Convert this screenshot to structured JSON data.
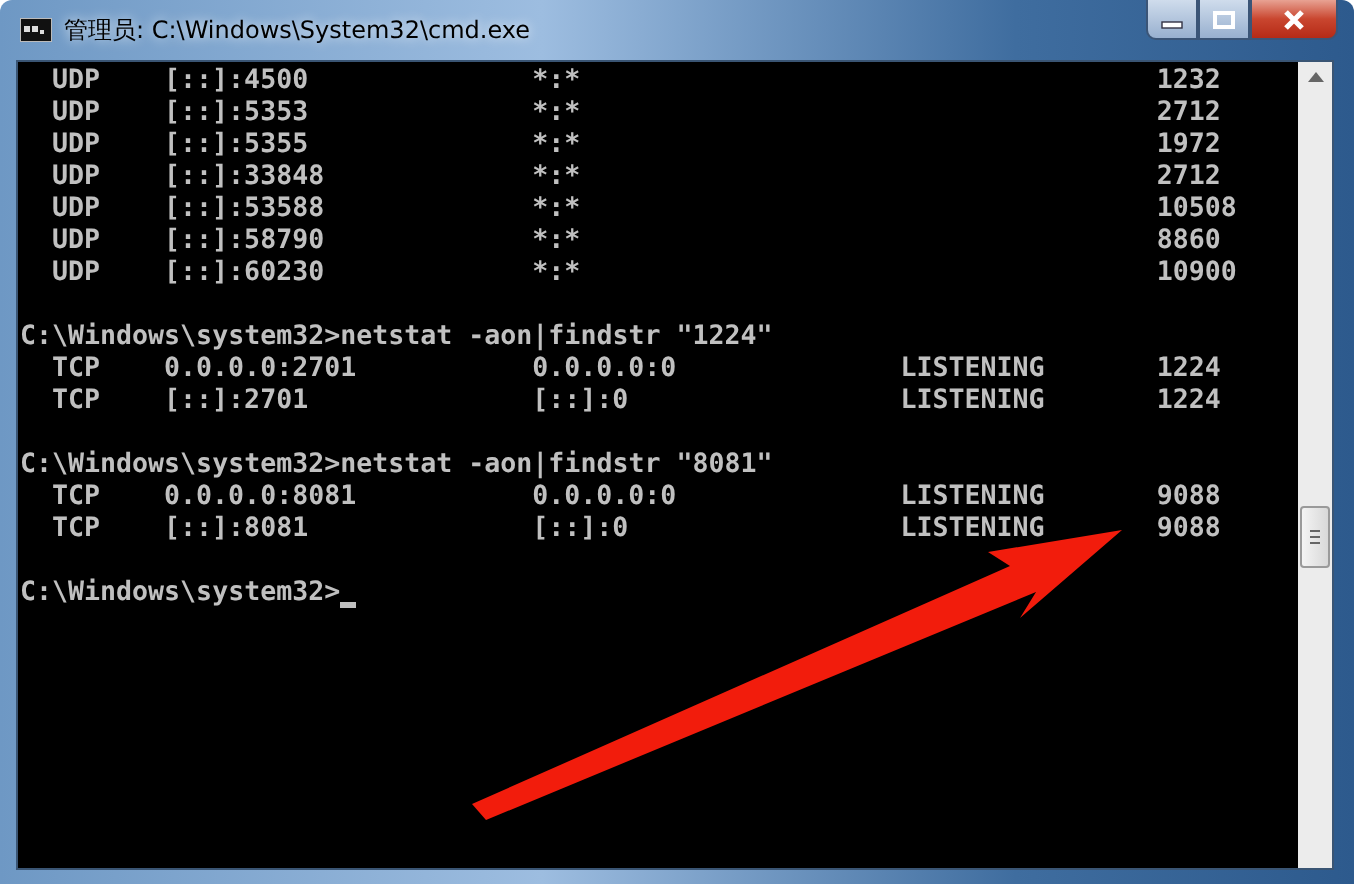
{
  "window": {
    "title": "管理员: C:\\Windows\\System32\\cmd.exe"
  },
  "console": {
    "lines": [
      {
        "kind": "row",
        "proto": "UDP",
        "local": "[::]:4500",
        "foreign": "*:*",
        "pid": "1232"
      },
      {
        "kind": "row",
        "proto": "UDP",
        "local": "[::]:5353",
        "foreign": "*:*",
        "pid": "2712"
      },
      {
        "kind": "row",
        "proto": "UDP",
        "local": "[::]:5355",
        "foreign": "*:*",
        "pid": "1972"
      },
      {
        "kind": "row",
        "proto": "UDP",
        "local": "[::]:33848",
        "foreign": "*:*",
        "pid": "2712"
      },
      {
        "kind": "row",
        "proto": "UDP",
        "local": "[::]:53588",
        "foreign": "*:*",
        "pid": "10508"
      },
      {
        "kind": "row",
        "proto": "UDP",
        "local": "[::]:58790",
        "foreign": "*:*",
        "pid": "8860"
      },
      {
        "kind": "row",
        "proto": "UDP",
        "local": "[::]:60230",
        "foreign": "*:*",
        "pid": "10900"
      },
      {
        "kind": "blank"
      },
      {
        "kind": "command",
        "prompt": "C:\\Windows\\system32>",
        "command": "netstat -aon|findstr \"1224\""
      },
      {
        "kind": "row",
        "proto": "TCP",
        "local": "0.0.0.0:2701",
        "foreign": "0.0.0.0:0",
        "state": "LISTENING",
        "pid": "1224"
      },
      {
        "kind": "row",
        "proto": "TCP",
        "local": "[::]:2701",
        "foreign": "[::]:0",
        "state": "LISTENING",
        "pid": "1224"
      },
      {
        "kind": "blank"
      },
      {
        "kind": "command",
        "prompt": "C:\\Windows\\system32>",
        "command": "netstat -aon|findstr \"8081\""
      },
      {
        "kind": "row",
        "proto": "TCP",
        "local": "0.0.0.0:8081",
        "foreign": "0.0.0.0:0",
        "state": "LISTENING",
        "pid": "9088"
      },
      {
        "kind": "row",
        "proto": "TCP",
        "local": "[::]:8081",
        "foreign": "[::]:0",
        "state": "LISTENING",
        "pid": "9088"
      },
      {
        "kind": "blank"
      },
      {
        "kind": "command",
        "prompt": "C:\\Windows\\system32>",
        "cursor": true
      }
    ]
  },
  "annotation": {
    "kind": "arrow"
  }
}
